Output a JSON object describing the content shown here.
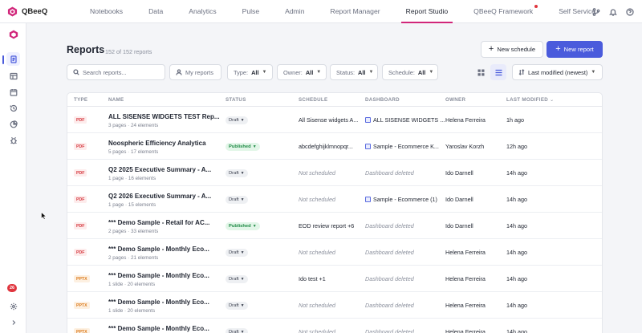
{
  "app": {
    "name": "QBeeQ"
  },
  "nav": [
    {
      "label": "Notebooks"
    },
    {
      "label": "Data"
    },
    {
      "label": "Analytics"
    },
    {
      "label": "Pulse"
    },
    {
      "label": "Admin"
    },
    {
      "label": "Report Manager"
    },
    {
      "label": "Report Studio",
      "active": true
    },
    {
      "label": "QBeeQ Framework",
      "has_dot": true
    },
    {
      "label": "Self Service"
    }
  ],
  "sidebar": {
    "notification_count": "26"
  },
  "page": {
    "title": "Reports",
    "count": "152 of 152 reports",
    "new_schedule": "New schedule",
    "new_report": "New report"
  },
  "filters": {
    "search_placeholder": "Search reports...",
    "my_reports": "My reports",
    "type_label": "Type:",
    "type_value": "All",
    "owner_label": "Owner:",
    "owner_value": "All",
    "status_label": "Status:",
    "status_value": "All",
    "schedule_label": "Schedule:",
    "schedule_value": "All",
    "sort": "Last modified (newest)"
  },
  "columns": {
    "type": "TYPE",
    "name": "NAME",
    "status": "STATUS",
    "schedule": "SCHEDULE",
    "dashboard": "DASHBOARD",
    "owner": "OWNER",
    "modified": "LAST MODIFIED"
  },
  "rows": [
    {
      "type": "PDF",
      "name": "ALL SISENSE WIDGETS TEST Rep...",
      "meta": "3 pages · 24 elements",
      "status": "Draft",
      "schedule": "All Sisense widgets A...",
      "schedule_muted": false,
      "dashboard": "ALL SISENSE WIDGETS ...",
      "dashboard_muted": false,
      "owner": "Helena Ferreira",
      "modified": "1h ago"
    },
    {
      "type": "PDF",
      "name": "Noospheric Efficiency Analytica",
      "meta": "5 pages · 17 elements",
      "status": "Published",
      "schedule": "abcdefghijklmnopqr...",
      "schedule_muted": false,
      "dashboard": "Sample - Ecommerce K...",
      "dashboard_muted": false,
      "owner": "Yaroslav Korzh",
      "modified": "12h ago"
    },
    {
      "type": "PDF",
      "name": "Q2 2025 Executive Summary - A...",
      "meta": "1 page · 16 elements",
      "status": "Draft",
      "schedule": "Not scheduled",
      "schedule_muted": true,
      "dashboard": "Dashboard deleted",
      "dashboard_muted": true,
      "owner": "Ido Darnell",
      "modified": "14h ago"
    },
    {
      "type": "PDF",
      "name": "Q2 2026 Executive Summary - A...",
      "meta": "1 page · 15 elements",
      "status": "Draft",
      "schedule": "Not scheduled",
      "schedule_muted": true,
      "dashboard": "Sample - Ecommerce (1)",
      "dashboard_muted": false,
      "owner": "Ido Darnell",
      "modified": "14h ago"
    },
    {
      "type": "PDF",
      "name": "*** Demo Sample - Retail for AC...",
      "meta": "2 pages · 33 elements",
      "status": "Published",
      "schedule": "EOD review report +6",
      "schedule_muted": false,
      "dashboard": "Dashboard deleted",
      "dashboard_muted": true,
      "owner": "Ido Darnell",
      "modified": "14h ago"
    },
    {
      "type": "PDF",
      "name": "*** Demo Sample - Monthly Eco...",
      "meta": "2 pages · 21 elements",
      "status": "Draft",
      "schedule": "Not scheduled",
      "schedule_muted": true,
      "dashboard": "Dashboard deleted",
      "dashboard_muted": true,
      "owner": "Helena Ferreira",
      "modified": "14h ago"
    },
    {
      "type": "PPTX",
      "name": "*** Demo Sample - Monthly Eco...",
      "meta": "1 slide · 20 elements",
      "status": "Draft",
      "schedule": "Ido test +1",
      "schedule_muted": false,
      "dashboard": "Dashboard deleted",
      "dashboard_muted": true,
      "owner": "Helena Ferreira",
      "modified": "14h ago"
    },
    {
      "type": "PPTX",
      "name": "*** Demo Sample - Monthly Eco...",
      "meta": "1 slide · 20 elements",
      "status": "Draft",
      "schedule": "Not scheduled",
      "schedule_muted": true,
      "dashboard": "Dashboard deleted",
      "dashboard_muted": true,
      "owner": "Helena Ferreira",
      "modified": "14h ago"
    },
    {
      "type": "PPTX",
      "name": "*** Demo Sample - Monthly Eco...",
      "meta": "",
      "status": "Draft",
      "schedule": "Not scheduled",
      "schedule_muted": true,
      "dashboard": "Dashboard deleted",
      "dashboard_muted": true,
      "owner": "Helena Ferreira",
      "modified": "14h ago"
    }
  ],
  "colors": {
    "accent": "#4a5bdc",
    "active_tab": "#d1267a",
    "pdf": "#d6383f",
    "pptx": "#dc7b1c",
    "published": "#1e8a45"
  }
}
